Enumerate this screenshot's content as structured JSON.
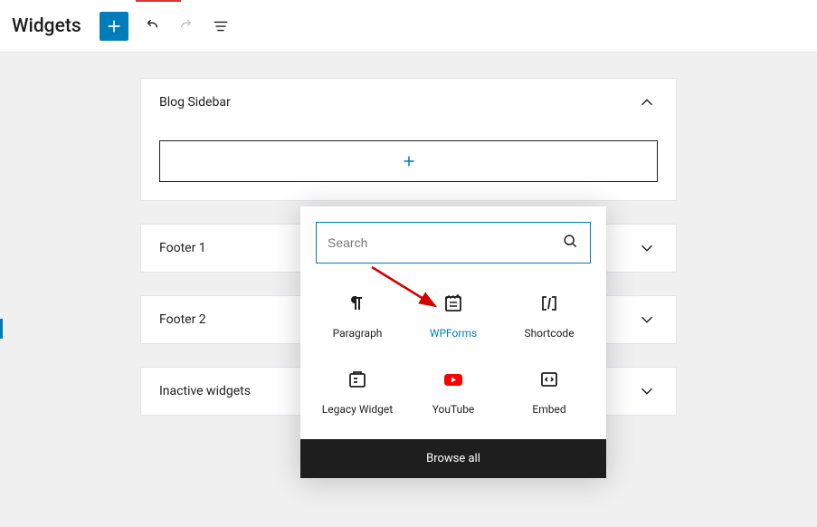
{
  "header": {
    "title": "Widgets"
  },
  "widgetAreas": [
    {
      "title": "Blog Sidebar",
      "expanded": true
    },
    {
      "title": "Footer 1",
      "expanded": false
    },
    {
      "title": "Footer 2",
      "expanded": false
    },
    {
      "title": "Inactive widgets",
      "expanded": false
    }
  ],
  "inserter": {
    "searchPlaceholder": "Search",
    "blocks": [
      {
        "label": "Paragraph",
        "icon": "paragraph"
      },
      {
        "label": "WPForms",
        "icon": "wpforms",
        "highlight": true
      },
      {
        "label": "Shortcode",
        "icon": "shortcode"
      },
      {
        "label": "Legacy Widget",
        "icon": "legacy"
      },
      {
        "label": "YouTube",
        "icon": "youtube"
      },
      {
        "label": "Embed",
        "icon": "embed"
      }
    ],
    "browseAllLabel": "Browse all"
  },
  "colors": {
    "accent": "#007cba",
    "youtubeRed": "#ff0000"
  }
}
